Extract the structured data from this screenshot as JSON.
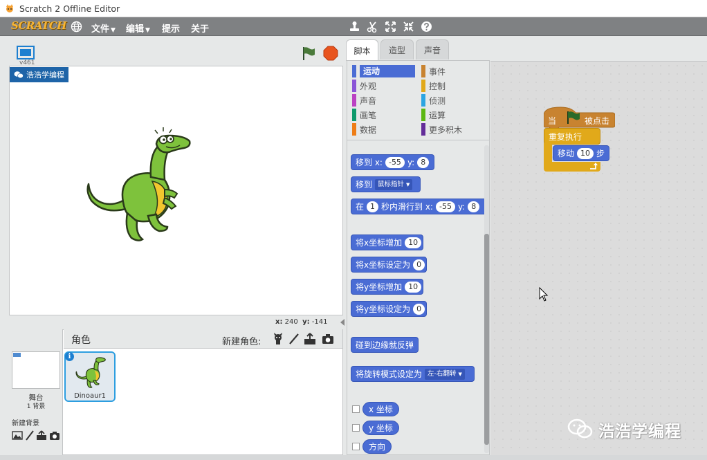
{
  "window": {
    "title": "Scratch 2 Offline Editor"
  },
  "menubar": {
    "logo": "SCRATCH",
    "menus": [
      {
        "label": "文件",
        "has_caret": true
      },
      {
        "label": "编辑",
        "has_caret": true
      },
      {
        "label": "提示",
        "has_caret": false
      },
      {
        "label": "关于",
        "has_caret": false
      }
    ],
    "caret": "▼",
    "tools": [
      "duplicate-stamp-icon",
      "cut-scissors-icon",
      "grow-arrows-icon",
      "shrink-arrows-icon",
      "help-icon"
    ]
  },
  "stage": {
    "version": "v461",
    "watermark_label": "浩浩学编程",
    "mouse_x_label": "x:",
    "mouse_x": "240",
    "mouse_y_label": "y:",
    "mouse_y": "-141"
  },
  "sprites_pane": {
    "title": "角色",
    "new_sprite_label": "新建角色:",
    "stage_label": "舞台",
    "stage_backdrops": "1 背景",
    "new_backdrop_label": "新建背景",
    "sprite_name": "Dinoaur1",
    "info_glyph": "i"
  },
  "tabs": [
    {
      "label": "脚本",
      "active": true
    },
    {
      "label": "造型",
      "active": false
    },
    {
      "label": "声音",
      "active": false
    }
  ],
  "categories": [
    {
      "label": "运动",
      "color": "#4a6cd4",
      "active": true
    },
    {
      "label": "事件",
      "color": "#c88330",
      "active": false
    },
    {
      "label": "外观",
      "color": "#8a55d7",
      "active": false
    },
    {
      "label": "控制",
      "color": "#e1a91a",
      "active": false
    },
    {
      "label": "声音",
      "color": "#bb42c3",
      "active": false
    },
    {
      "label": "侦测",
      "color": "#2ca5e2",
      "active": false
    },
    {
      "label": "画笔",
      "color": "#0e9a6c",
      "active": false
    },
    {
      "label": "运算",
      "color": "#5cb712",
      "active": false
    },
    {
      "label": "数据",
      "color": "#ee7d16",
      "active": false
    },
    {
      "label": "更多积木",
      "color": "#632d99",
      "active": false
    }
  ],
  "palette_blocks": {
    "goto_xy": {
      "label": "移到 x:",
      "x": "-55",
      "y_label": "y:",
      "y": "8"
    },
    "goto_target": {
      "label": "移到",
      "target": "鼠标指针"
    },
    "glide": {
      "prefix": "在",
      "secs": "1",
      "mid": "秒内滑行到 x:",
      "x": "-55",
      "y_label": "y:",
      "y": "8"
    },
    "change_x": {
      "label": "将x坐标增加",
      "value": "10"
    },
    "set_x": {
      "label": "将x坐标设定为",
      "value": "0"
    },
    "change_y": {
      "label": "将y坐标增加",
      "value": "10"
    },
    "set_y": {
      "label": "将y坐标设定为",
      "value": "0"
    },
    "bounce": {
      "label": "碰到边缘就反弹"
    },
    "rotation_style": {
      "label": "将旋转模式设定为",
      "value": "左-右翻转"
    },
    "reporters": [
      {
        "label": "x 坐标"
      },
      {
        "label": "y 坐标"
      },
      {
        "label": "方向"
      }
    ]
  },
  "script": {
    "hat_prefix": "当",
    "hat_suffix": "被点击",
    "forever_label": "重复执行",
    "move_label": "移动",
    "move_steps": "10",
    "move_suffix": "步"
  },
  "watermark": {
    "text": "浩浩学编程"
  }
}
